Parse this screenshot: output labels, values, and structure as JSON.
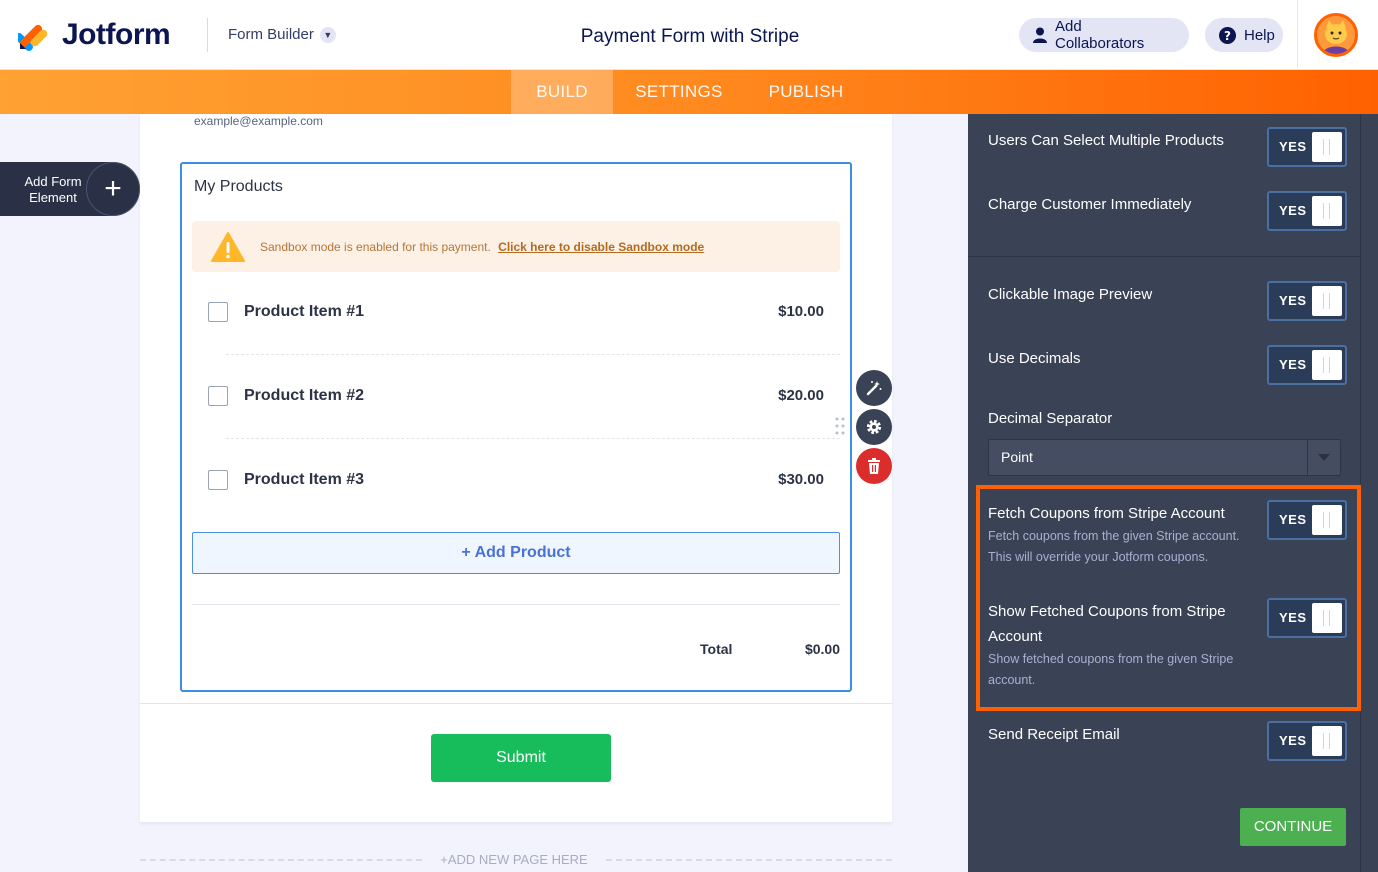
{
  "header": {
    "logo_text": "Jotform",
    "builder_label": "Form Builder",
    "form_title": "Payment Form with Stripe",
    "collab_label": "Add Collaborators",
    "help_label": "Help"
  },
  "nav": {
    "tabs": [
      {
        "label": "BUILD",
        "active": true
      },
      {
        "label": "SETTINGS",
        "active": false
      },
      {
        "label": "PUBLISH",
        "active": false
      }
    ]
  },
  "sidebar": {
    "add_element_label": "Add Form Element"
  },
  "form": {
    "email_hint": "example@example.com",
    "products_label": "My Products",
    "sandbox_text": "Sandbox mode is enabled for this payment.",
    "sandbox_link": "Click here to disable Sandbox mode",
    "products": [
      {
        "name": "Product Item #1",
        "price": "$10.00"
      },
      {
        "name": "Product Item #2",
        "price": "$20.00"
      },
      {
        "name": "Product Item #3",
        "price": "$30.00"
      }
    ],
    "add_product_label": "+ Add Product",
    "total_label": "Total",
    "total_value": "$0.00",
    "submit_label": "Submit",
    "add_new_page_label": "+ADD NEW PAGE HERE"
  },
  "panel": {
    "multiple_products": {
      "label": "Users Can Select Multiple Products",
      "value": "YES"
    },
    "charge_immediately": {
      "label": "Charge Customer Immediately",
      "value": "YES"
    },
    "image_preview": {
      "label": "Clickable Image Preview",
      "value": "YES"
    },
    "use_decimals": {
      "label": "Use Decimals",
      "value": "YES"
    },
    "decimal_separator": {
      "label": "Decimal Separator",
      "value": "Point"
    },
    "fetch_coupons": {
      "label": "Fetch Coupons from Stripe Account",
      "desc": "Fetch coupons from the given Stripe account. This will override your Jotform coupons.",
      "value": "YES"
    },
    "show_coupons": {
      "label": "Show Fetched Coupons from Stripe Account",
      "desc": "Show fetched coupons from the given Stripe account.",
      "value": "YES"
    },
    "receipt_email": {
      "label": "Send Receipt Email",
      "value": "YES"
    },
    "continue_label": "CONTINUE"
  },
  "colors": {
    "accent_orange": "#ff6100",
    "panel_bg": "#3a4255",
    "submit_green": "#18bd5b",
    "continue_green": "#4caf50",
    "selection_blue": "#3d8ee0"
  }
}
